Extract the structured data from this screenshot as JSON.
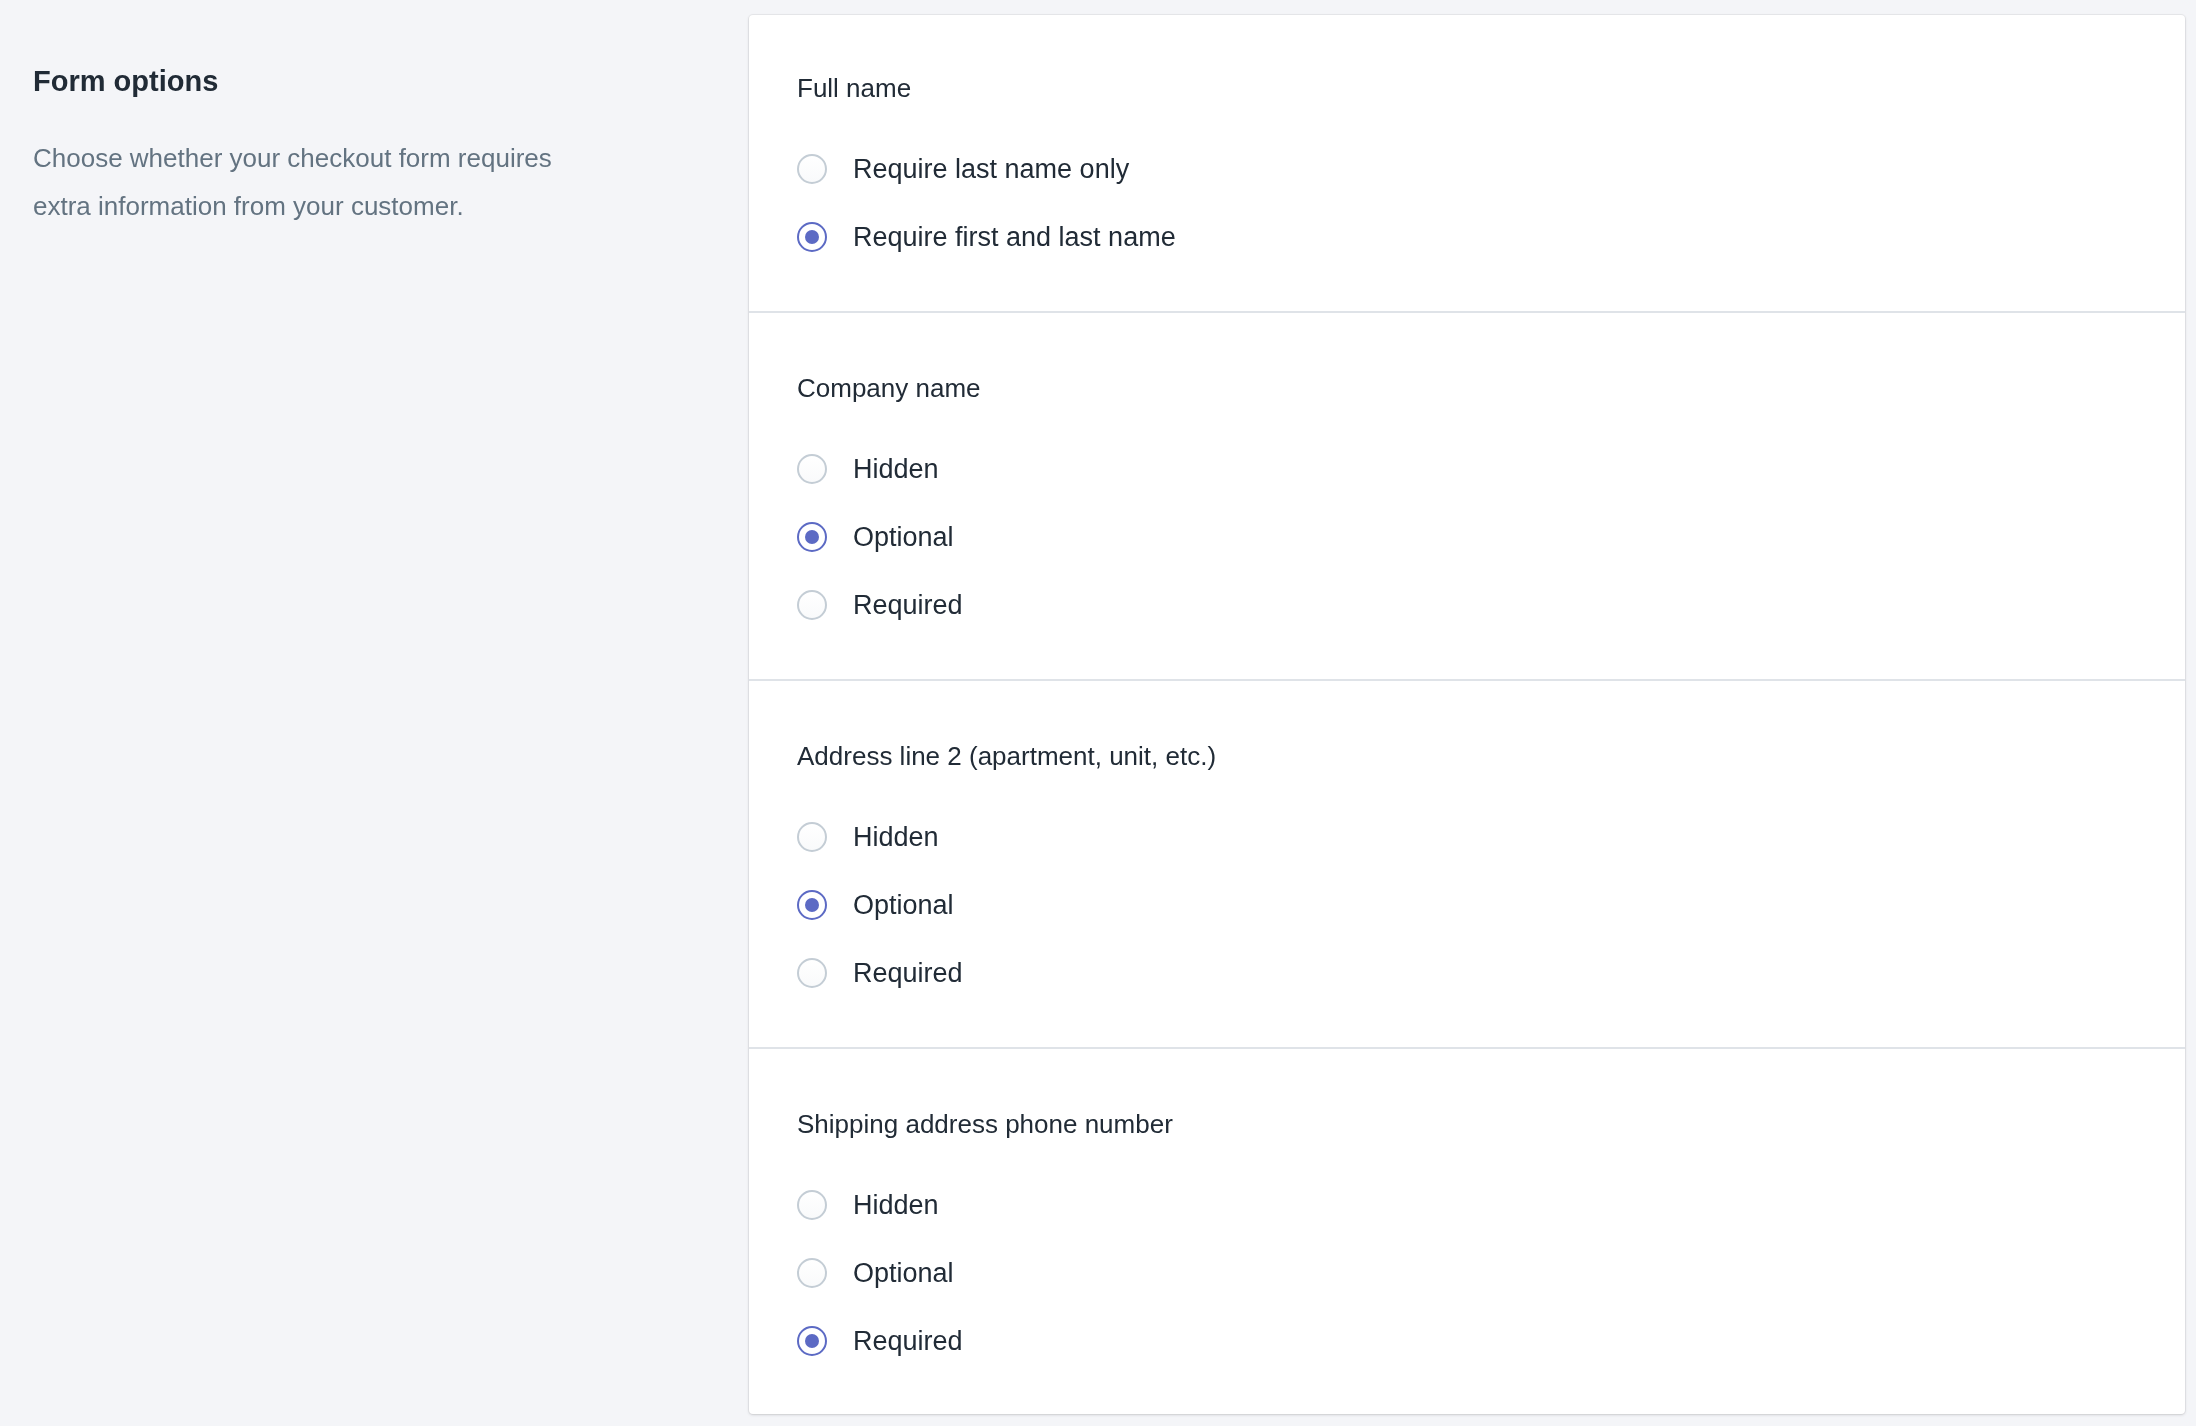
{
  "sidebar": {
    "title": "Form options",
    "description": "Choose whether your checkout form requires extra information from your customer."
  },
  "sections": [
    {
      "title": "Full name",
      "options": [
        {
          "label": "Require last name only",
          "selected": false
        },
        {
          "label": "Require first and last name",
          "selected": true
        }
      ]
    },
    {
      "title": "Company name",
      "options": [
        {
          "label": "Hidden",
          "selected": false
        },
        {
          "label": "Optional",
          "selected": true
        },
        {
          "label": "Required",
          "selected": false
        }
      ]
    },
    {
      "title": "Address line 2 (apartment, unit, etc.)",
      "options": [
        {
          "label": "Hidden",
          "selected": false
        },
        {
          "label": "Optional",
          "selected": true
        },
        {
          "label": "Required",
          "selected": false
        }
      ]
    },
    {
      "title": "Shipping address phone number",
      "options": [
        {
          "label": "Hidden",
          "selected": false
        },
        {
          "label": "Optional",
          "selected": false
        },
        {
          "label": "Required",
          "selected": true
        }
      ]
    }
  ]
}
